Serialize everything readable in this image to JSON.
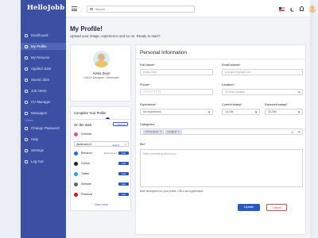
{
  "app": {
    "brand": "HelloJobb"
  },
  "sidebar": {
    "items": [
      {
        "label": "Dashboard",
        "active": false
      },
      {
        "label": "My Profile",
        "active": true
      },
      {
        "label": "My Resume",
        "active": false
      },
      {
        "label": "Applied Jobs",
        "active": false
      },
      {
        "label": "Saved Jobs",
        "active": false
      },
      {
        "label": "Job Alerts",
        "active": false
      },
      {
        "label": "CV Manager",
        "active": false
      },
      {
        "label": "Messages",
        "active": false
      }
    ],
    "section_label": "Others",
    "bottom_items": [
      {
        "label": "Change Password"
      },
      {
        "label": "Help"
      },
      {
        "label": "Settings"
      },
      {
        "label": "Log Out"
      }
    ]
  },
  "topbar": {
    "search_placeholder": "Search"
  },
  "page": {
    "title": "My Profile!",
    "subtitle": "Upload your image, experience and so on. Ready to start?"
  },
  "profile": {
    "name": "Aisha Zeyn",
    "role": "UI&UX Designer / Developer"
  },
  "completion": {
    "title": "Complete Your Profile",
    "value_fraction": 0.62
  },
  "on_the_web": {
    "title": "On the Web",
    "add_label": "+ Add link",
    "input_value": "@aishazeyn1",
    "submit_label": "Submit",
    "cancel_label": "✕",
    "links": [
      {
        "name": "Dribbble",
        "handle": "",
        "color": "#ea4c89",
        "button": ""
      },
      {
        "name": "Behance",
        "handle": "@behance1",
        "color": "#1769ff",
        "button": "Link"
      },
      {
        "name": "GitHub",
        "handle": "",
        "color": "#222222",
        "button": "Link"
      },
      {
        "name": "Twitter",
        "handle": "",
        "color": "#1da1f2",
        "button": "Link"
      },
      {
        "name": "Website",
        "handle": "",
        "color": "#5b6470",
        "button": "Link"
      },
      {
        "name": "Pinterest",
        "handle": "",
        "color": "#e60023",
        "button": "Link"
      }
    ],
    "view_more": "View more"
  },
  "personal_info": {
    "title": "Personal Information",
    "full_name_label": "Full Name*",
    "full_name_placeholder": "Aisha Zeyn",
    "email_label": "Email adress*",
    "email_placeholder": "example@gmail.com",
    "phone_label": "Phone*",
    "phone_placeholder": "777 777 77 77",
    "location_label": "Location*",
    "location_placeholder": "Choose location",
    "experience_label": "Experience*",
    "experience_value": "No experience",
    "current_salary_label": "Current salary*",
    "current_salary_value": "10-15k",
    "expected_salary_label": "Expected salary*",
    "expected_salary_value": "20-25k",
    "categories_label": "Categories",
    "categories": [
      "UX Designer",
      "Designer"
    ],
    "bio_label": "Bio*",
    "bio_placeholder": "Write something about you",
    "bio_hint": "Brief description for your profile. URLs are hyperlinked.",
    "update_label": "Update",
    "cancel_label": "Cancel"
  }
}
